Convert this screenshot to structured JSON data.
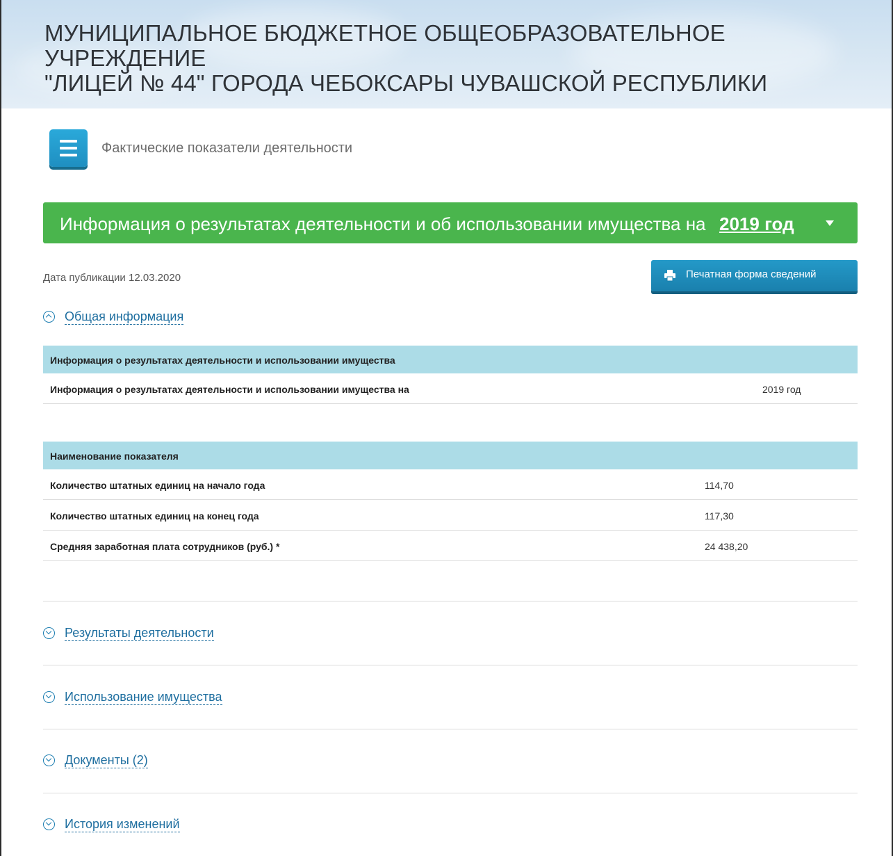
{
  "header": {
    "title_line1": "МУНИЦИПАЛЬНОЕ БЮДЖЕТНОЕ ОБЩЕОБРАЗОВАТЕЛЬНОЕ УЧРЕЖДЕНИЕ",
    "title_line2": "\"ЛИЦЕЙ № 44\" ГОРОДА ЧЕБОКСАРЫ ЧУВАШСКОЙ РЕСПУБЛИКИ"
  },
  "menu": {
    "label": "Фактические показатели деятельности",
    "icon": "hamburger-menu-icon"
  },
  "banner": {
    "text": "Информация о результатах деятельности и об использовании имущества на",
    "year": "2019 год",
    "color": "#4ab54d"
  },
  "publication": {
    "date_text": "Дата публикации 12.03.2020"
  },
  "print_button": {
    "label": "Печатная форма сведений",
    "icon": "printer-icon"
  },
  "sections": {
    "general": "Общая информация",
    "results": "Результаты деятельности",
    "property": "Использование имущества",
    "documents": "Документы (2)",
    "history": "История изменений"
  },
  "table1": {
    "header": "Информация о результатах деятельности и использовании имущества",
    "rows": [
      {
        "name": "Информация о результатах деятельности и использовании имущества на",
        "value": "2019 год"
      }
    ]
  },
  "table2": {
    "header": "Наименование показателя",
    "rows": [
      {
        "name": "Количество штатных единиц на начало года",
        "value": "114,70"
      },
      {
        "name": "Количество штатных единиц на конец года",
        "value": "117,30"
      },
      {
        "name": "Средняя заработная плата сотрудников (руб.) *",
        "value": "24 438,20"
      }
    ]
  },
  "colors": {
    "accent_blue": "#1f8fc1",
    "table_header": "#acdce7",
    "link": "#1f6fa0"
  }
}
